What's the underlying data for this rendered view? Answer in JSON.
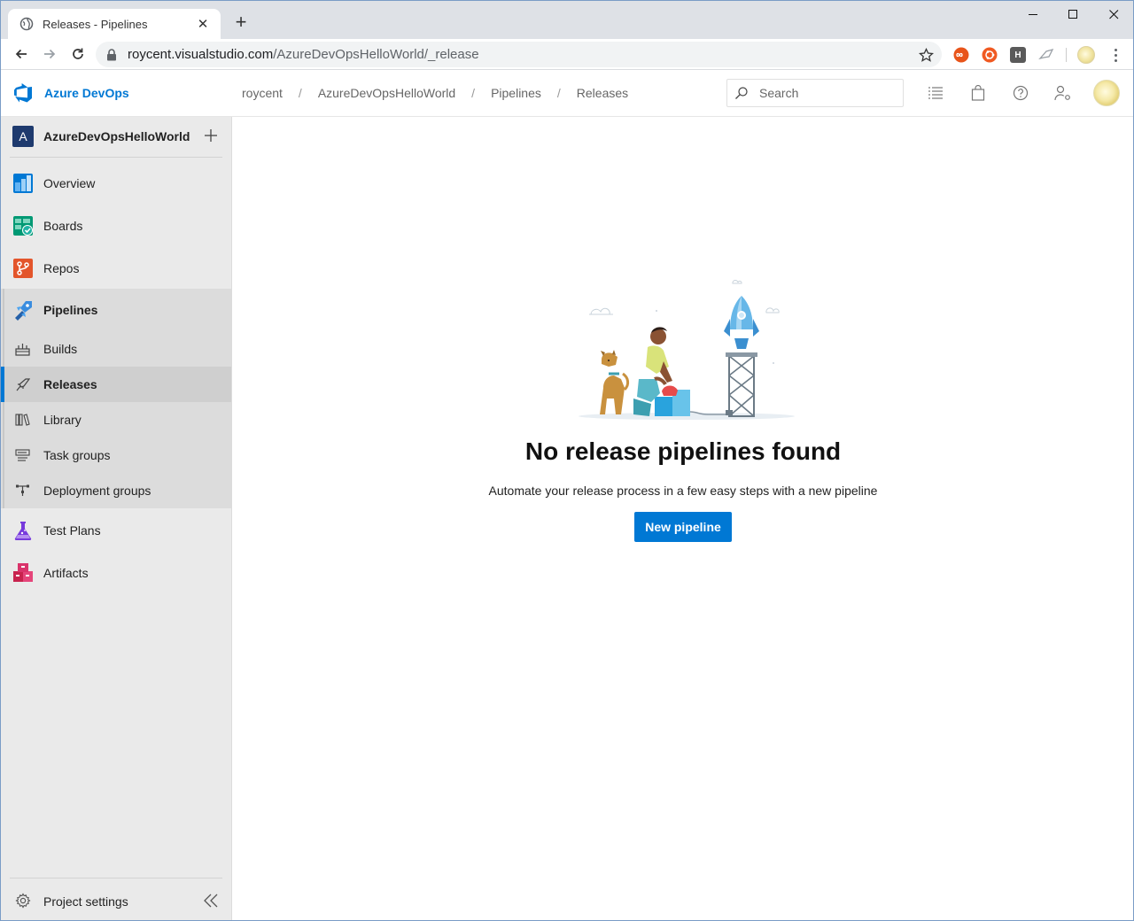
{
  "browser": {
    "tab_title": "Releases - Pipelines",
    "url_host": "roycent.visualstudio.com",
    "url_path": "/AzureDevOpsHelloWorld/_release",
    "extensions": [
      {
        "icon": "infinity-extension-icon",
        "color": "#e8541a"
      },
      {
        "icon": "ubuntu-extension-icon",
        "color": "#f05a22"
      },
      {
        "icon": "h-extension-icon",
        "label": "H",
        "color": "#555555"
      },
      {
        "icon": "bird-extension-icon",
        "color": "#9aa0a6"
      },
      {
        "icon": "profile-extension-icon",
        "color": "#e8dc8a"
      }
    ]
  },
  "header": {
    "brand": "Azure DevOps",
    "breadcrumb": [
      "roycent",
      "AzureDevOpsHelloWorld",
      "Pipelines",
      "Releases"
    ],
    "breadcrumb_sep": "/",
    "search_placeholder": "Search",
    "icons": [
      "list-icon",
      "shopping-bag-icon",
      "help-icon",
      "user-settings-icon"
    ]
  },
  "sidebar": {
    "project_initial": "A",
    "project_name": "AzureDevOpsHelloWorld",
    "items": [
      {
        "label": "Overview",
        "icon": "overview-icon"
      },
      {
        "label": "Boards",
        "icon": "boards-icon"
      },
      {
        "label": "Repos",
        "icon": "repos-icon"
      },
      {
        "label": "Pipelines",
        "icon": "pipelines-icon"
      },
      {
        "label": "Test Plans",
        "icon": "test-plans-icon"
      },
      {
        "label": "Artifacts",
        "icon": "artifacts-icon"
      }
    ],
    "pipelines_subitems": [
      {
        "label": "Builds",
        "icon": "builds-icon"
      },
      {
        "label": "Releases",
        "icon": "releases-icon",
        "active": true
      },
      {
        "label": "Library",
        "icon": "library-icon"
      },
      {
        "label": "Task groups",
        "icon": "task-groups-icon"
      },
      {
        "label": "Deployment groups",
        "icon": "deployment-groups-icon"
      }
    ],
    "settings_label": "Project settings"
  },
  "main": {
    "empty_title": "No release pipelines found",
    "empty_description": "Automate your release process in a few easy steps with a new pipeline",
    "new_pipeline_label": "New pipeline"
  },
  "colors": {
    "accent": "#0078d4",
    "sidebar_bg": "#eaeaea"
  }
}
